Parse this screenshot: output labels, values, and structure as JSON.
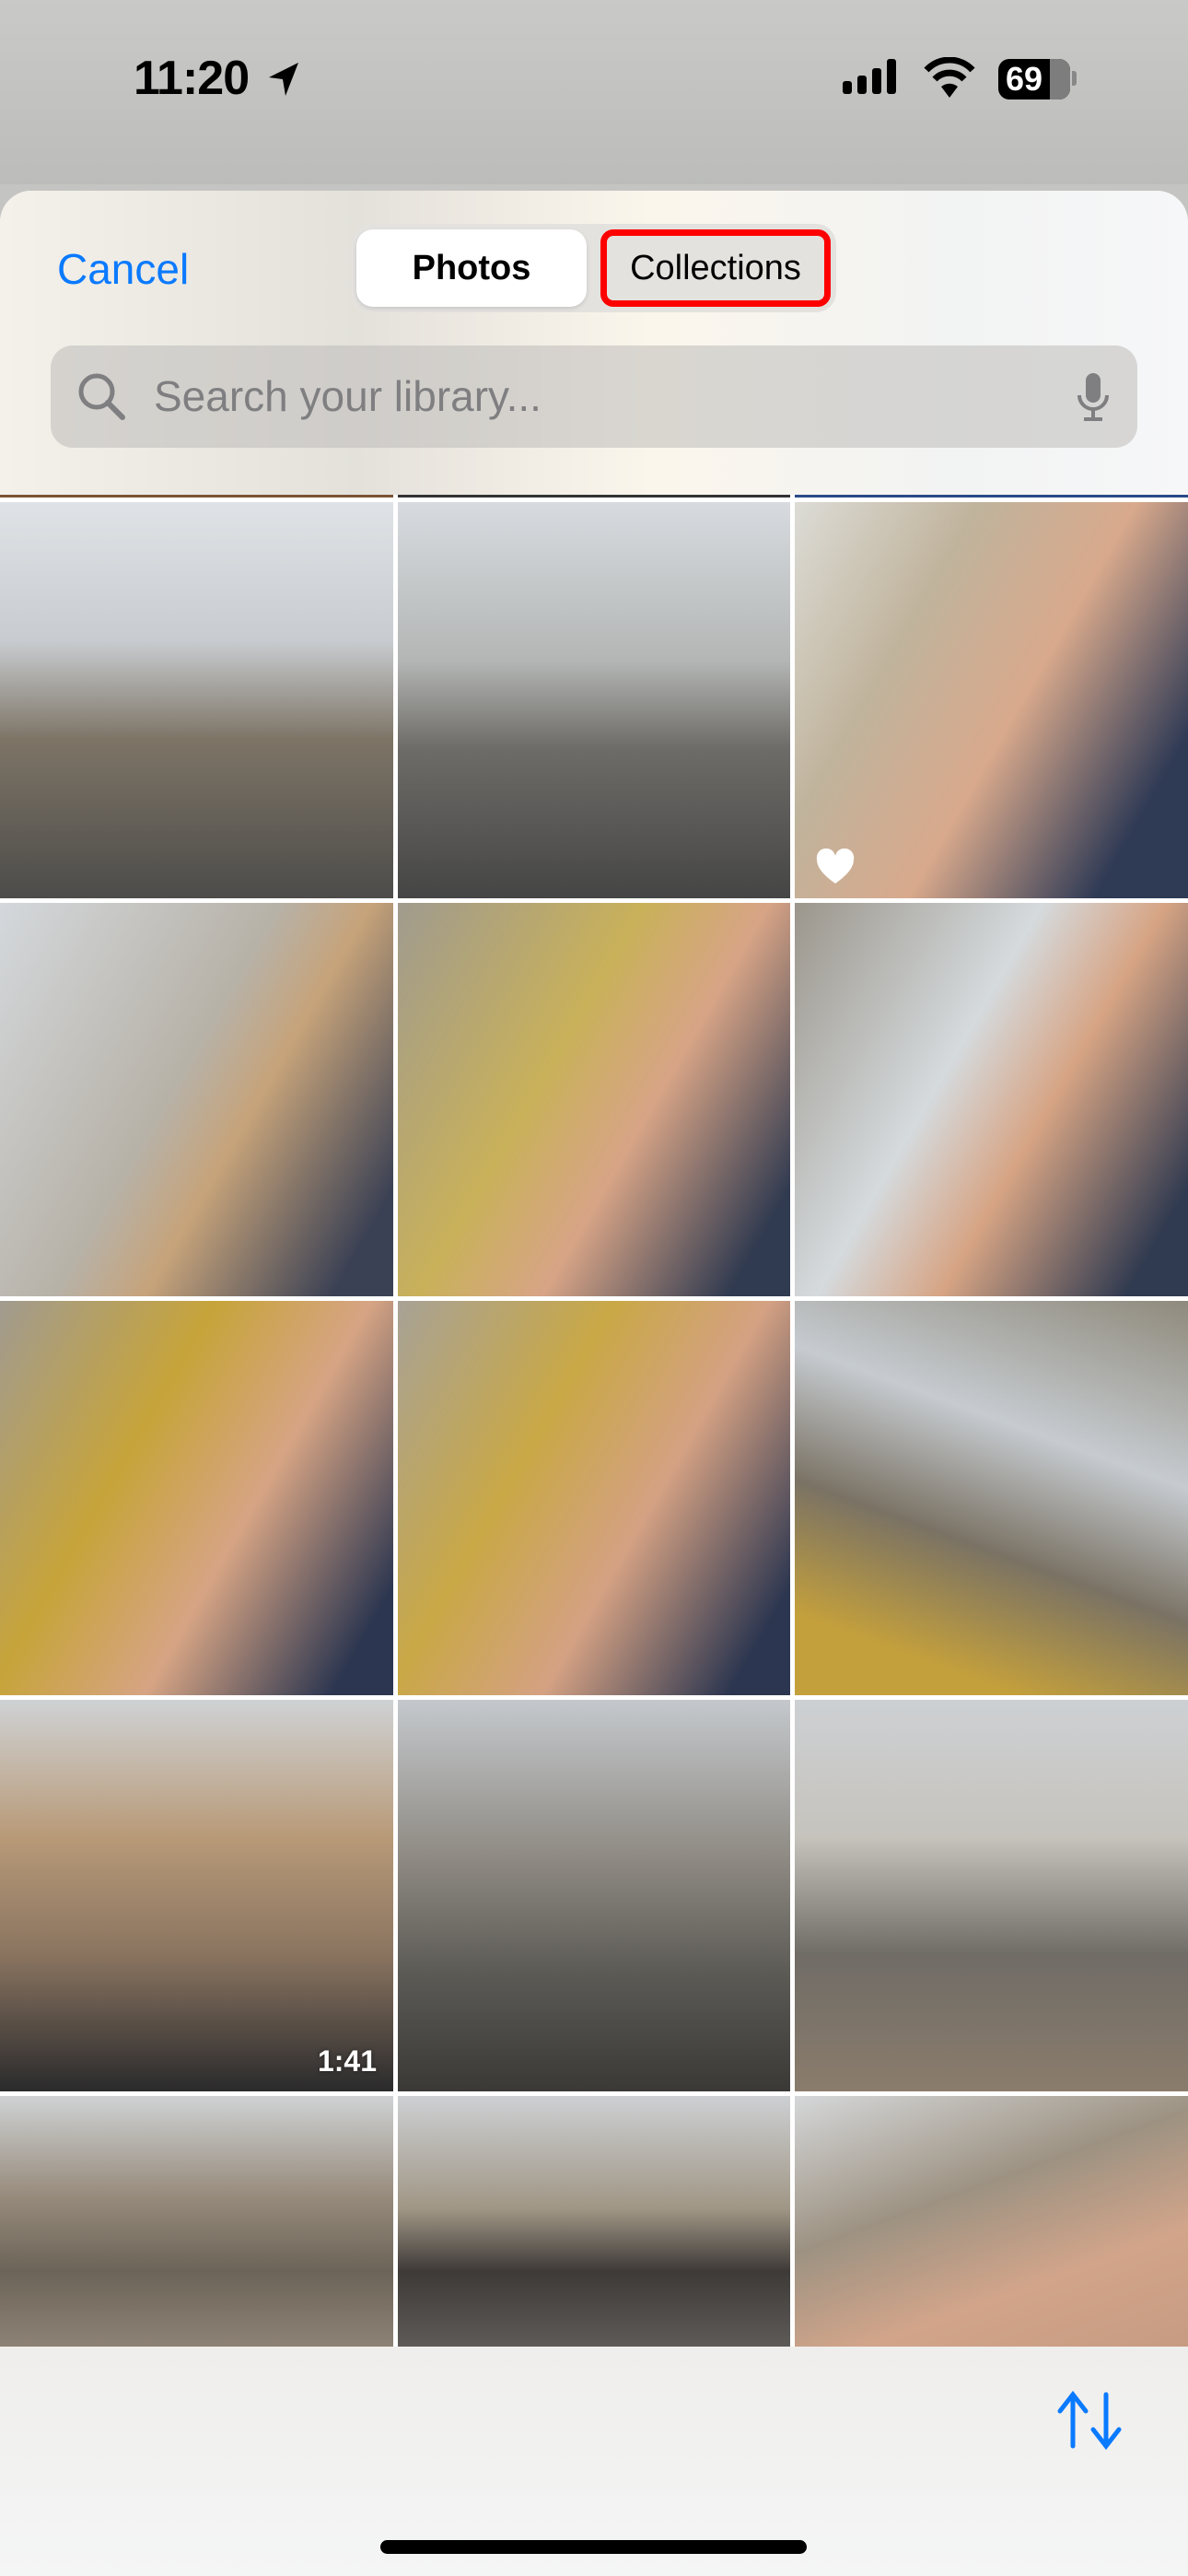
{
  "status_bar": {
    "time": "11:20",
    "battery": "69",
    "icons": [
      "location-arrow-icon",
      "cellular-signal-icon",
      "wifi-icon",
      "battery-icon"
    ]
  },
  "header": {
    "cancel_label": "Cancel",
    "segments": [
      {
        "label": "Photos",
        "selected": true
      },
      {
        "label": "Collections",
        "selected": false,
        "highlighted": true
      }
    ],
    "search": {
      "placeholder": "Search your library...",
      "value": ""
    }
  },
  "grid": {
    "columns": 3,
    "overlays": {
      "favorite_cell": 2,
      "video_cell": 9,
      "video_duration": "1:41"
    }
  },
  "bottom_bar": {
    "sort_icon": "arrow-up-down-icon"
  },
  "colors": {
    "accent": "#0a7aff",
    "highlight": "#ff0000"
  }
}
